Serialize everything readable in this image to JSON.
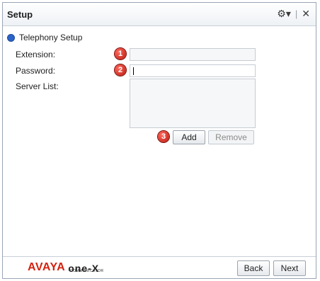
{
  "window": {
    "title": "Setup"
  },
  "titlebar": {
    "gear_icon": "gear-icon",
    "close_icon": "close-icon"
  },
  "section": {
    "label": "Telephony Setup"
  },
  "form": {
    "extension_label": "Extension:",
    "extension_value": "",
    "password_label": "Password:",
    "password_value": "",
    "server_list_label": "Server List:",
    "server_list_items": []
  },
  "badges": {
    "one": "1",
    "two": "2",
    "three": "3"
  },
  "buttons": {
    "add": "Add",
    "remove": "Remove",
    "back": "Back",
    "next": "Next"
  },
  "logo": {
    "brand": "AVAYA",
    "product": "one-X",
    "product_sub": "COMMUNICATOR"
  },
  "colors": {
    "accent": "#d3220f",
    "bullet": "#2a63c9",
    "badge": "#c81e10"
  }
}
